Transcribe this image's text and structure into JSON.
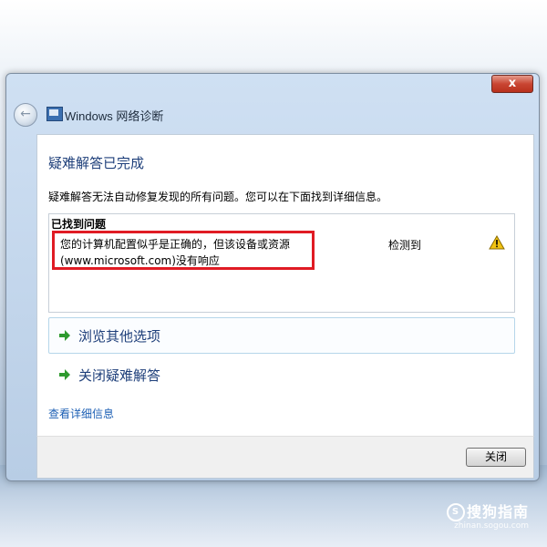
{
  "window": {
    "title": "Windows 网络诊断",
    "close_glyph": "x"
  },
  "content": {
    "heading": "疑难解答已完成",
    "description": "疑难解答无法自动修复发现的所有问题。您可以在下面找到详细信息。",
    "problems_header": "已找到问题",
    "problem": {
      "text": "您的计算机配置似乎是正确的，但该设备或资源(www.microsoft.com)没有响应",
      "status": "检测到",
      "icon": "warning-icon",
      "highlight_color": "#e01b24"
    },
    "options": [
      {
        "label": "浏览其他选项",
        "icon": "green-arrow-icon"
      },
      {
        "label": "关闭疑难解答",
        "icon": "green-arrow-icon"
      }
    ],
    "details_link": "查看详细信息"
  },
  "footer": {
    "close_label": "关闭"
  },
  "watermark": {
    "main": "搜狗指南",
    "sub": "zhinan.sogou.com",
    "logo": "S"
  },
  "colors": {
    "heading_blue": "#1e3f7a",
    "link_blue": "#1c5fb4",
    "arrow_green": "#2e9a2e",
    "warning_yellow": "#f2c311"
  }
}
